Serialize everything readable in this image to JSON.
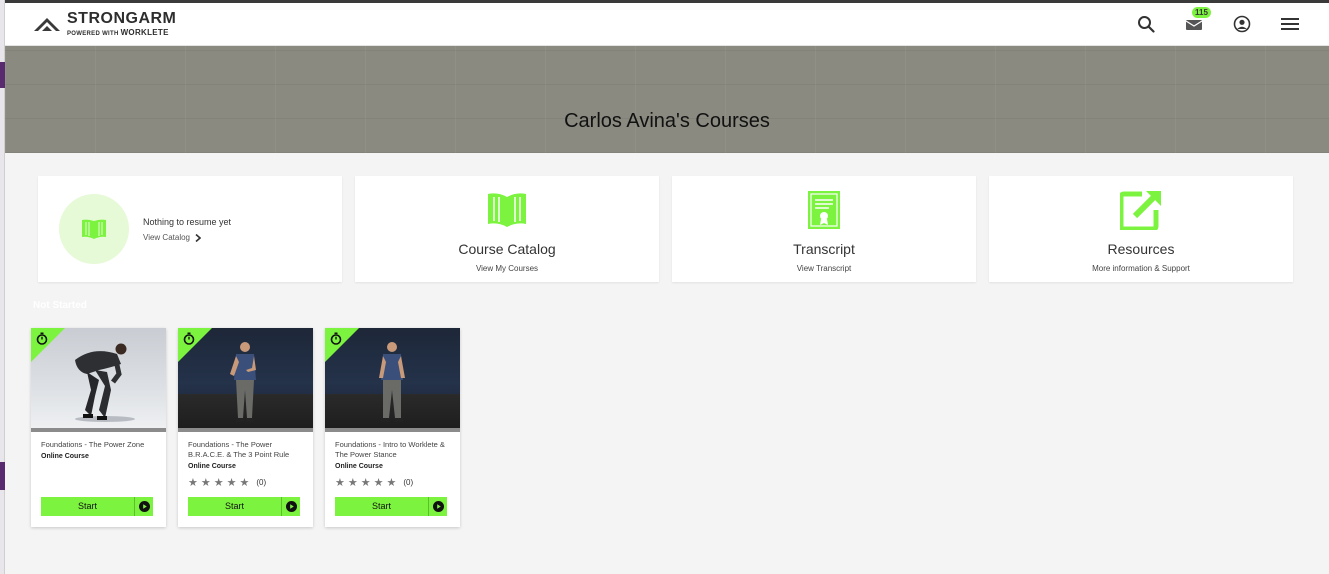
{
  "header": {
    "logo_main": "STRONGARM",
    "logo_sub_prefix": "POWERED WITH",
    "logo_sub_brand": "WORKLETE",
    "notification_count": "115"
  },
  "hero": {
    "title": "Carlos Avina's Courses"
  },
  "tiles": {
    "resume": {
      "title": "Nothing to resume yet",
      "link": "View Catalog"
    },
    "catalog": {
      "title": "Course Catalog",
      "link": "View My Courses"
    },
    "transcript": {
      "title": "Transcript",
      "link": "View Transcript"
    },
    "resources": {
      "title": "Resources",
      "link": "More information & Support"
    }
  },
  "section_label": "Not Started",
  "courses": [
    {
      "title": "Foundations - The Power Zone",
      "type": "Online Course",
      "button": "Start"
    },
    {
      "title": "Foundations - The Power B.R.A.C.E. & The 3 Point Rule",
      "type": "Online Course",
      "rating_count": "(0)",
      "button": "Start"
    },
    {
      "title": "Foundations - Intro to Worklete & The Power Stance",
      "type": "Online Course",
      "rating_count": "(0)",
      "button": "Start"
    }
  ],
  "colors": {
    "accent": "#7cf43f",
    "hero_bg": "#8a8a80"
  }
}
